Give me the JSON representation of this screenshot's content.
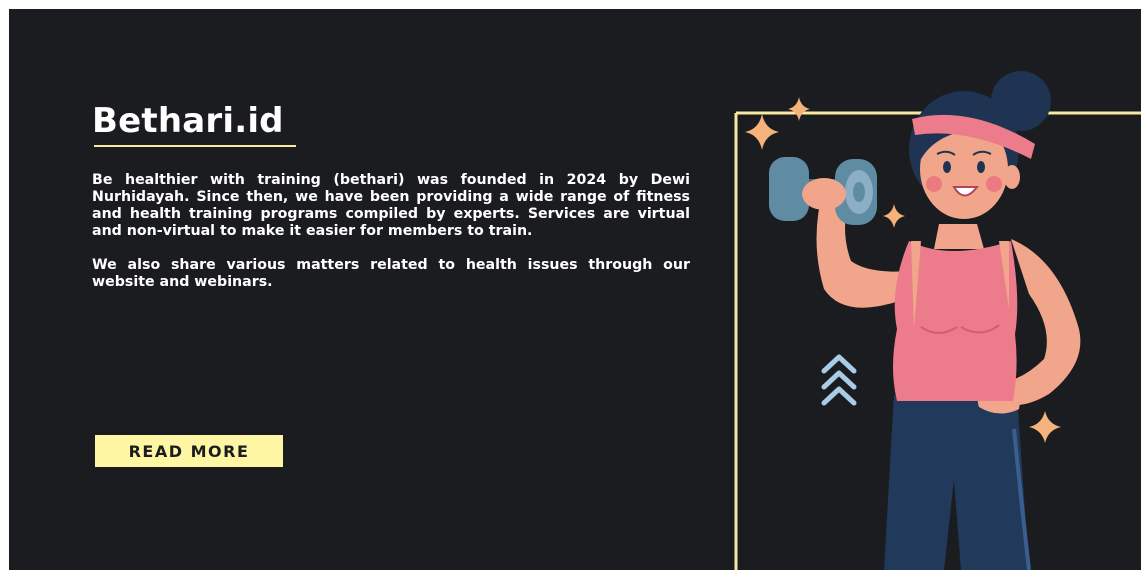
{
  "brand": {
    "title": "Bethari.id"
  },
  "about": {
    "paragraph1": "Be healthier with training (bethari) was founded in 2024 by Dewi Nurhidayah. Since then, we have been providing a wide range of fitness and health training programs compiled by experts. Services are virtual and non-virtual to make it easier for members to train.",
    "paragraph2": "We also share various matters related to health issues through our website and webinars."
  },
  "cta": {
    "read_more_label": "READ MORE"
  },
  "illustration": {
    "icon": "woman-lifting-dumbbell-illustration",
    "colors": {
      "background": "#1b1c1f",
      "accent_yellow": "#fff6a3",
      "frame_line": "#f7e9a0",
      "sparkle": "#f5b27a",
      "tank_top": "#ec7b8c",
      "skin": "#f1a58a",
      "hair": "#1f3352",
      "pants": "#213a5c",
      "dumbbell": "#5f8ba3",
      "chevrons": "#a8cbe8"
    }
  }
}
